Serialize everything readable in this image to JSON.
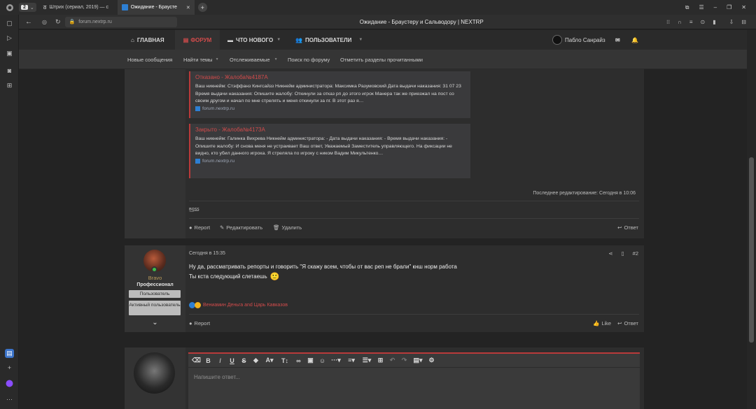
{
  "browser": {
    "tab_count": "2",
    "tabs": [
      {
        "title": "Штрих (сериал, 2019) — с"
      },
      {
        "title": "Ожидание - Браусте"
      }
    ],
    "url": "forum.nextrp.ru",
    "page_title": "Ожидание - Браустеру и Сальводору | NEXTRP"
  },
  "nav": {
    "home": "ГЛАВНАЯ",
    "forum": "ФОРУМ",
    "whats_new": "ЧТО НОВОГО",
    "users": "ПОЛЬЗОВАТЕЛИ",
    "username": "Пабло Санрайз"
  },
  "subnav": {
    "new_messages": "Новые сообщения",
    "find_topics": "Найти темы",
    "watched": "Отслеживаемые",
    "search_forum": "Поиск по форуму",
    "mark_read": "Отметить разделы прочитанными"
  },
  "post1": {
    "quotes": [
      {
        "title": "Отказано - Жалоба№4187А",
        "text": "Ваш никнейм: Стэффанз Кингсайзз Никнейм администратора: Максимка Разумовский Дата выдачи наказания: 31 07 23 Время выдачи наказания: Опишите жалобу: Откинули за отказ рп до этого игрок Манера так же приезжал на пост со своим другом и начал по мне стрелять и меня откинули за пг. В этот раз я…",
        "source": "forum.nextrp.ru"
      },
      {
        "title": "Закрыто - Жалоба№4173А",
        "text": "Ваш никнейм: Галинка Вихрева Никнейм администратора: - Дата выдачи наказания: - Время выдачи наказания: - Опишите жалобу: И снова меня не устраивает Ваш ответ, Уважаемый Заместитель управляющего. На фиксации не видно, кто убил данного игрока. Я стреляла по игроку с ником Вадим Микультенко…",
        "source": "forum.nextrp.ru"
      }
    ],
    "edited": "Последнее редактирование: Сегодня в 10:06",
    "signature": "ʙ͟ᴏ͟s͟s",
    "report": "Report",
    "edit": "Редактировать",
    "delete": "Удалить",
    "reply": "Ответ"
  },
  "post2": {
    "author": "Bravo",
    "title": "Профессионал",
    "badges": [
      "Пользователь",
      "Активный пользователь"
    ],
    "time": "Сегодня в 15:35",
    "number": "#2",
    "line1": "Ну да, рассматривать репорты и говорить \"Я скажу всем, чтобы от вас реп не брали\" кнш норм работа",
    "line2": "Ты кста следующий слетаешь",
    "emoji": "🙂",
    "reactions": "Вениамин Деньга and Царь Кавказов",
    "report": "Report",
    "like": "Like",
    "reply": "Ответ"
  },
  "editor": {
    "placeholder": "Напишите ответ..."
  },
  "colors": {
    "accent_red": "#d14b4b",
    "background": "#232323",
    "panel": "#2d2d2d"
  }
}
